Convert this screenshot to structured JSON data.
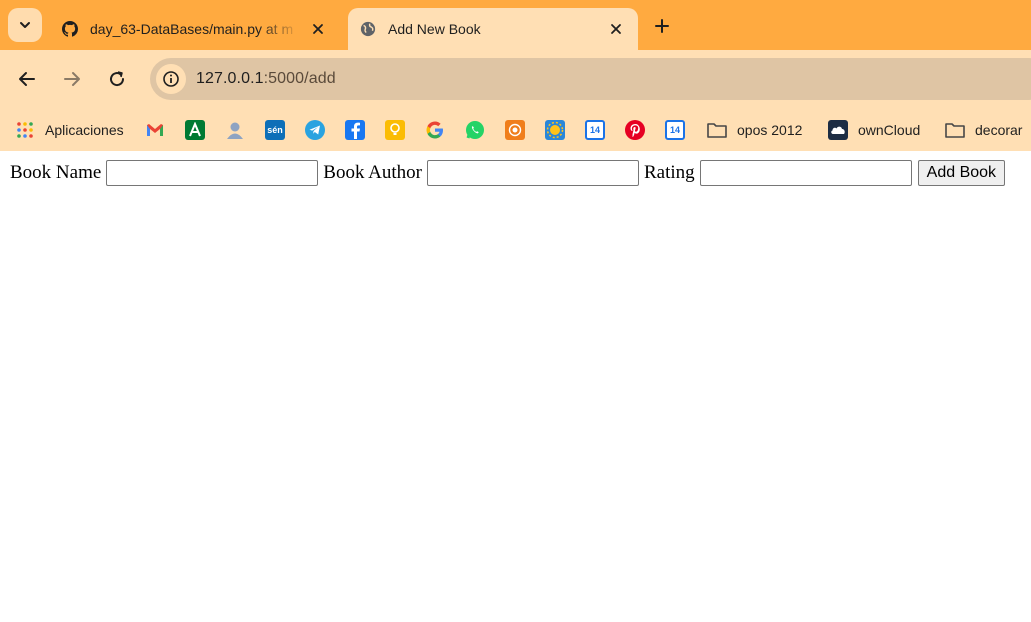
{
  "browser": {
    "tabs": [
      {
        "title": "day_63-DataBases/main.py at m",
        "favicon": "github-icon",
        "active": false
      },
      {
        "title": "Add New Book",
        "favicon": "globe-icon",
        "active": true
      }
    ],
    "url_host": "127.0.0.1",
    "url_path": ":5000/add",
    "bookmarks": [
      {
        "label": "Aplicaciones",
        "icon": "apps-grid-icon"
      },
      {
        "label": "",
        "icon": "gmail-icon"
      },
      {
        "label": "",
        "icon": "andalucia-icon"
      },
      {
        "label": "",
        "icon": "avatar-icon"
      },
      {
        "label": "",
        "icon": "sen-icon",
        "text": "sén"
      },
      {
        "label": "",
        "icon": "telegram-icon"
      },
      {
        "label": "",
        "icon": "facebook-icon"
      },
      {
        "label": "",
        "icon": "keep-icon"
      },
      {
        "label": "",
        "icon": "google-icon"
      },
      {
        "label": "",
        "icon": "whatsapp-icon"
      },
      {
        "label": "",
        "icon": "lion-icon"
      },
      {
        "label": "",
        "icon": "sun-icon"
      },
      {
        "label": "",
        "icon": "calendar-icon",
        "text": "14"
      },
      {
        "label": "",
        "icon": "pinterest-icon"
      },
      {
        "label": "",
        "icon": "calendar-icon",
        "text": "14"
      },
      {
        "label": "opos 2012",
        "icon": "folder-icon"
      },
      {
        "label": "ownCloud",
        "icon": "owncloud-icon"
      },
      {
        "label": "decorar",
        "icon": "folder-icon"
      }
    ],
    "colors": {
      "frame": "#ffaa40",
      "toolbar": "#ffdfb4",
      "omnibox": "#dfc5a4"
    }
  },
  "form": {
    "book_name_label": "Book Name",
    "book_name_value": "",
    "book_author_label": "Book Author",
    "book_author_value": "",
    "rating_label": "Rating",
    "rating_value": "",
    "submit_label": "Add Book"
  }
}
